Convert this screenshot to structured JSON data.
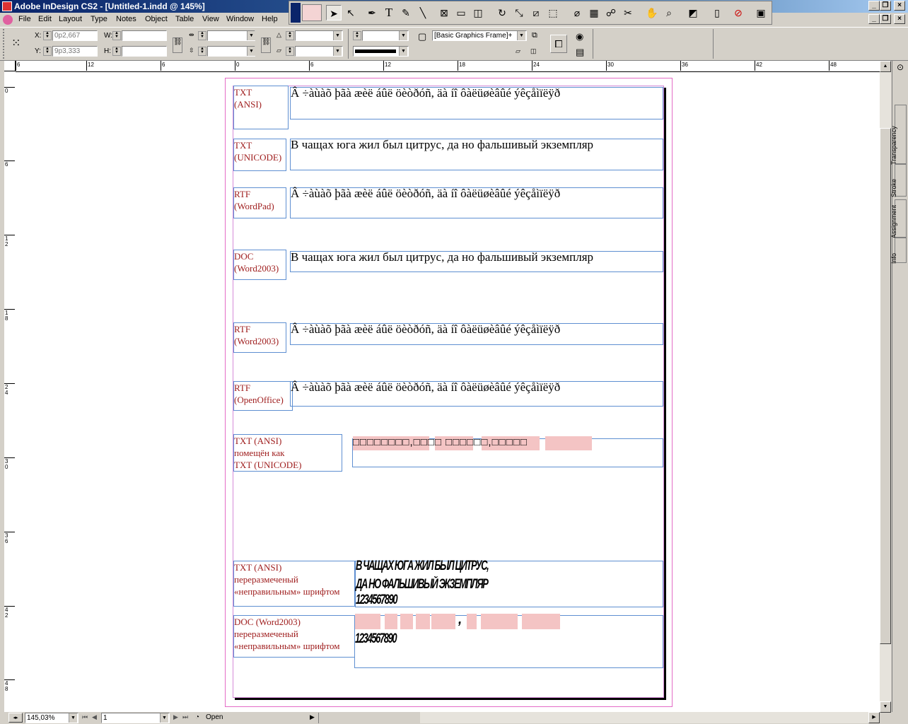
{
  "window": {
    "title": "Adobe InDesign CS2 - [Untitled-1.indd @ 145%]"
  },
  "menu": [
    "File",
    "Edit",
    "Layout",
    "Type",
    "Notes",
    "Object",
    "Table",
    "View",
    "Window",
    "Help"
  ],
  "control": {
    "x_label": "X:",
    "x_value": "0p2,667",
    "y_label": "Y:",
    "y_value": "9p3,333",
    "w_label": "W:",
    "h_label": "H:",
    "object_style": "[Basic Graphics Frame]+"
  },
  "ruler_h": [
    "6",
    "0",
    "6",
    "12",
    "18",
    "24",
    "30",
    "36",
    "42",
    "48"
  ],
  "ruler_v": [
    "0",
    "6",
    "1 2",
    "1 8",
    "2 4",
    "3 0",
    "3 6",
    "4 2",
    "4 8"
  ],
  "side_tabs": [
    "Transparency",
    "Stroke",
    "Assignment",
    "Info"
  ],
  "rows": [
    {
      "label": "TXT\n(ANSI)",
      "content": "Â ÷àùàõ þãà æèë áûë öèòðóñ, äà íî ôàëüøèâûé ýêçåìïëÿð"
    },
    {
      "label": "TXT\n(UNICODE)",
      "content": "В чащах юга жил был цитрус, да но фальшивый экземпляр"
    },
    {
      "label": "RTF\n(WordPad)",
      "content": "Â ÷àùàõ þãà æèë áûë öèòðóñ, äà íî ôàëüøèâûé ýêçåìïëÿð"
    },
    {
      "label": "DOC\n(Word2003)",
      "content": "В чащах юга жил был цитрус, да но фальшивый экземпляр"
    },
    {
      "label": "RTF\n(Word2003)",
      "content": "Â ÷àùàõ þãà æèë áûë öèòðóñ, äà íî ôàëüøèâûé ýêçåìïëÿð"
    },
    {
      "label": "RTF\n(OpenOffice)",
      "content": "Â ÷àùàõ þãà æèë áûë öèòðóñ, äà íî ôàëüøèâûé ýêçåìïëÿð"
    },
    {
      "label": "TXT (ANSI)\nпомещён как\nTXT (UNICODE)",
      "content": "□□□□□□□□,□□□□ □□□□□□,□□□□□"
    },
    {
      "label": "TXT (ANSI)\nпереразмеченый\n«неправильным» шрифтом",
      "content_lines": [
        "В ЧАЩАХ ЮГА ЖИЛ БЫЛ ЦИТРУС,",
        "ДА НО ФАЛЬШИВЫЙ ЭКЗЕМПЛЯР",
        "1234567890"
      ]
    },
    {
      "label": "DOC (Word2003)\nпереразмеченый\n«неправильным» шрифтом",
      "content_comma": ",",
      "content_digits": "1234567890"
    }
  ],
  "status": {
    "zoom": "145,03%",
    "page": "1",
    "state": "Open"
  }
}
